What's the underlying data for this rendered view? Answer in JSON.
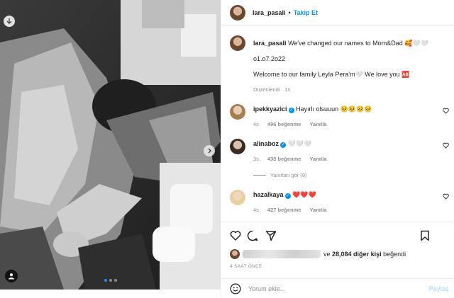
{
  "header": {
    "username": "lara_pasali",
    "separator": "•",
    "follow_label": "Takip Et"
  },
  "caption": {
    "username": "lara_pasali",
    "line1": "We've changed our names to Mom&Dad 🥰🤍🤍",
    "line2": "o1.o7.2o22",
    "line3": "Welcome to our family Leyla Pera'm🤍 We love you 🆎",
    "edited": "Düzenlendi",
    "edited_sep": "·",
    "edited_time": "1s"
  },
  "comments": [
    {
      "username": "ipekkyazici",
      "verified": true,
      "text": "Hayırlı olsuuun 🥺🥺🥺🥺",
      "time": "4s",
      "likes": "496 beğenme",
      "reply_label": "Yanıtla"
    },
    {
      "username": "alinaboz",
      "verified": true,
      "text": "🤍🤍🤍",
      "time": "3s",
      "likes": "435 beğenme",
      "reply_label": "Yanıtla"
    },
    {
      "username": "hazalkaya",
      "verified": true,
      "text": "❤️❤️❤️",
      "time": "4s",
      "likes": "427 beğenme",
      "reply_label": "Yanıtla"
    }
  ],
  "view_replies": "Yanıtları gör (9)",
  "likes_summary": {
    "and_label": "ve",
    "count": "28,084 diğer kişi",
    "suffix": "beğendi"
  },
  "post_time": "4 SAAT ÖNCE",
  "composer": {
    "placeholder": "Yorum ekle...",
    "post_label": "Paylaş"
  },
  "carousel": {
    "current": 1,
    "total": 3
  },
  "icons": [
    "bookmark-corner-icon",
    "chevron-right-icon",
    "user-tag-icon",
    "heart-icon",
    "comment-icon",
    "share-icon",
    "save-icon",
    "emoji-icon"
  ],
  "colors": {
    "accent": "#0095f6",
    "text": "#262626",
    "muted": "#8e8e8e",
    "like_red": "#ed4956"
  }
}
